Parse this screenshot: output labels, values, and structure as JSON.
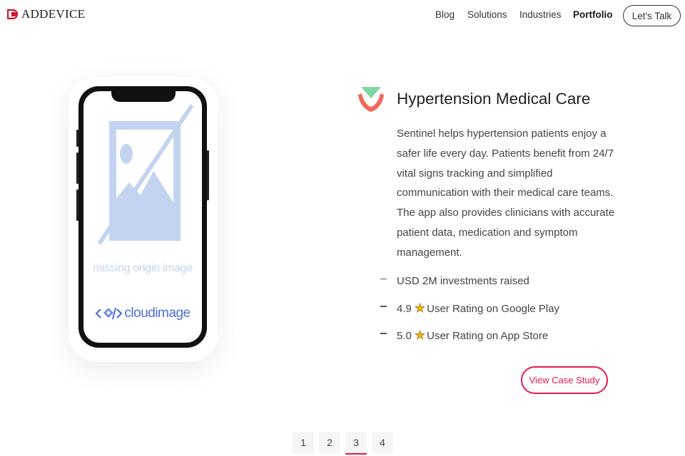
{
  "header": {
    "logo_text": "ADDEVICE",
    "nav": [
      {
        "label": "Blog"
      },
      {
        "label": "Solutions"
      },
      {
        "label": "Industries"
      },
      {
        "label": "Portfolio",
        "active": true
      }
    ],
    "cta_label": "Let's Talk"
  },
  "phone": {
    "placeholder_text": "missing origin image",
    "brand_text": "cloudimage"
  },
  "project": {
    "icon": "heart-check-icon",
    "title": "Hypertension Medical Care",
    "description": "Sentinel helps hypertension patients enjoy a safer life every day. Patients benefit from 24/7 vital signs tracking and simplified communication with their medical care teams. The app also provides clinicians with accurate patient data, medication and symptom management.",
    "stats": [
      {
        "text": "USD 2M investments raised",
        "prefix": "",
        "has_star": false
      },
      {
        "prefix": "4.9",
        "text": "User Rating on Google Play",
        "has_star": true
      },
      {
        "prefix": "5.0",
        "text": "User Rating on App Store",
        "has_star": true
      }
    ],
    "case_study_label": "View Case Study"
  },
  "pagination": {
    "pages": [
      "1",
      "2",
      "3",
      "4"
    ],
    "active": "3"
  },
  "colors": {
    "accent": "#e6194b",
    "icon_green": "#7fd6a4",
    "icon_red": "#ef6a5a",
    "placeholder_blue": "#c3d4f0",
    "cloudimage_blue": "#4a6fd6"
  }
}
